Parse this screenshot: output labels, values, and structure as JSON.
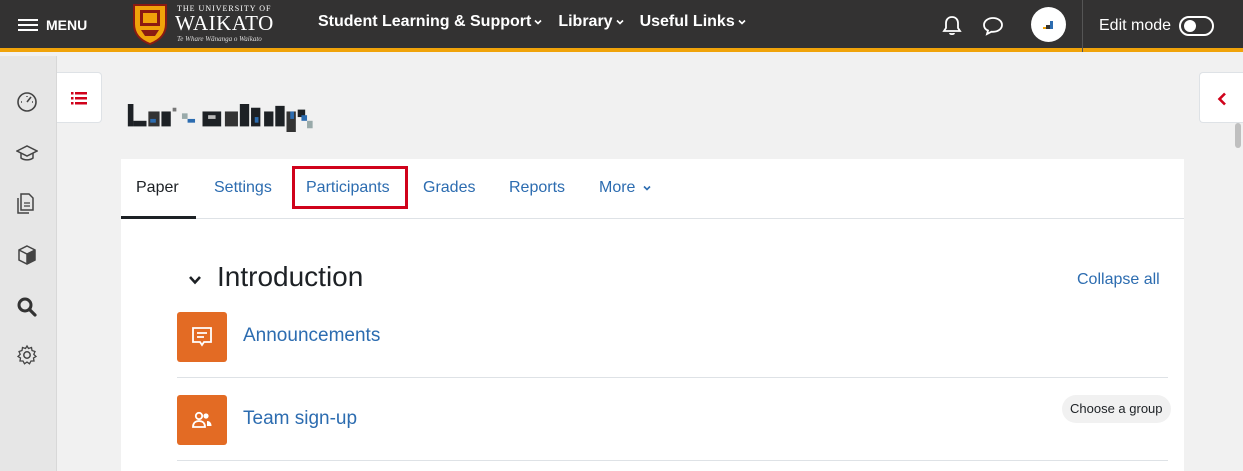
{
  "navbar": {
    "menu_label": "MENU",
    "logo": {
      "top_line": "THE UNIVERSITY OF",
      "name": "WAIKATO",
      "tagline": "Te Whare Wānanga o Waikato"
    },
    "links": [
      {
        "label": "Student Learning & Support"
      },
      {
        "label": "Library"
      },
      {
        "label": "Useful Links"
      }
    ],
    "edit_mode_label": "Edit mode",
    "edit_mode_on": false,
    "accent_color": "#f0a30a"
  },
  "tabs": [
    {
      "label": "Paper",
      "active": true
    },
    {
      "label": "Settings"
    },
    {
      "label": "Participants",
      "highlighted": true
    },
    {
      "label": "Grades"
    },
    {
      "label": "Reports"
    },
    {
      "label": "More"
    }
  ],
  "section": {
    "title": "Introduction",
    "collapse_label": "Collapse all"
  },
  "activities": [
    {
      "name": "Announcements",
      "icon": "forum-icon"
    },
    {
      "name": "Team sign-up",
      "icon": "group-choice-icon",
      "badge": "Choose a group"
    }
  ],
  "rail_icons": [
    "dashboard-icon",
    "graduation-cap-icon",
    "documents-icon",
    "cube-icon",
    "search-icon",
    "gear-icon"
  ],
  "colors": {
    "link": "#2c6cb0",
    "activity_icon_bg": "#e36b24",
    "highlight": "#d0021b"
  }
}
